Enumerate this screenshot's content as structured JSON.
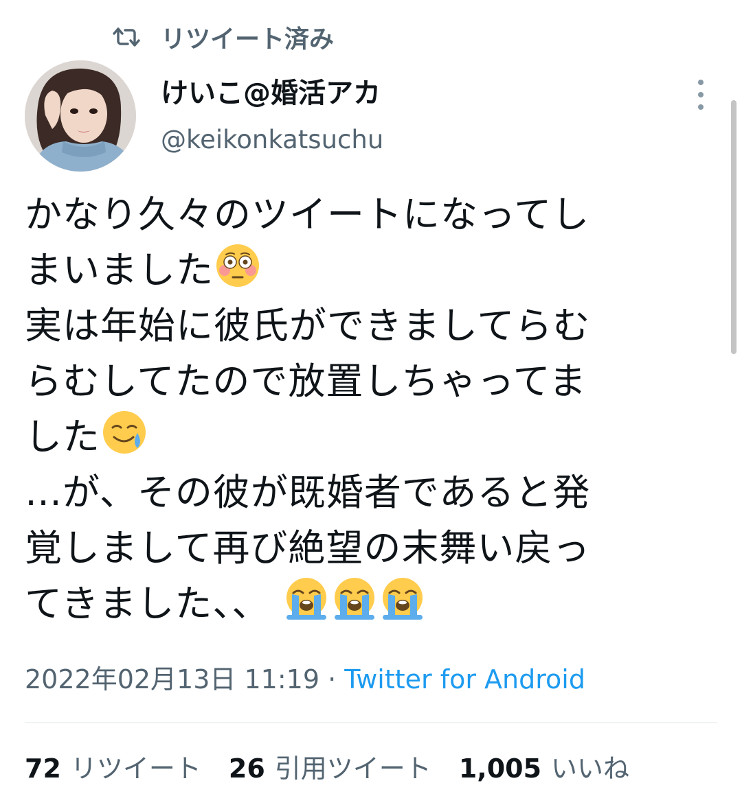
{
  "retweet_banner": {
    "icon": "retweet-icon",
    "label": "リツイート済み"
  },
  "author": {
    "display_name": "けいこ@婚活アカ",
    "handle": "@keikonkatsuchu",
    "avatar": "avatar-photo"
  },
  "tweet": {
    "lines": [
      "かなり久々のツイートになってし",
      "まいました",
      "実は年始に彼氏ができましてらむ",
      "らむしてたので放置しちゃってま",
      "した",
      "…が、その彼が既婚者であると発",
      "覚しまして再び絶望の末舞い戻っ",
      "てきました、、"
    ],
    "emojis": {
      "flushed": "flushed-face",
      "tear_smile": "smiling-face-with-tear",
      "crying": "loudly-crying-face"
    }
  },
  "meta": {
    "timestamp": "2022年02月13日 11:19",
    "separator": " · ",
    "source": "Twitter for Android"
  },
  "stats": {
    "retweets_count": "72",
    "retweets_label": "リツイート",
    "quotes_count": "26",
    "quotes_label": "引用ツイート",
    "likes_count": "1,005",
    "likes_label": "いいね"
  },
  "colors": {
    "secondary_text": "#536471",
    "link": "#1d9bf0",
    "primary_text": "#0f1419"
  }
}
